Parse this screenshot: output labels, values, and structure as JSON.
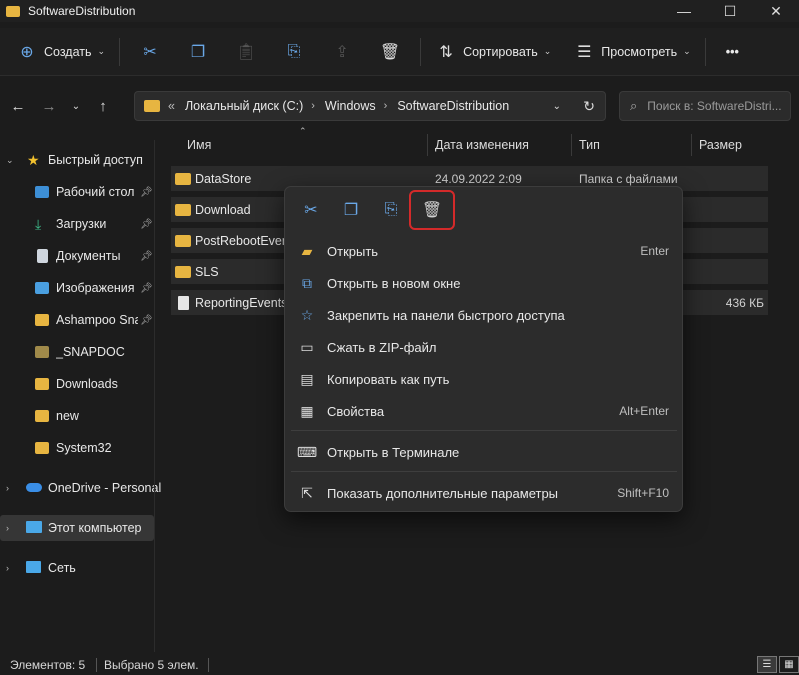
{
  "window": {
    "title": "SoftwareDistribution",
    "minimize_glyph": "—",
    "maximize_glyph": "☐",
    "close_glyph": "✕"
  },
  "toolbar": {
    "create_label": "Создать",
    "sort_label": "Сортировать",
    "view_label": "Просмотреть",
    "more_glyph": "•••"
  },
  "address": {
    "prefix": "«",
    "crumbs": [
      "Локальный диск (C:)",
      "Windows",
      "SoftwareDistribution"
    ],
    "search_placeholder": "Поиск в: SoftwareDistri..."
  },
  "sidebar": {
    "items": [
      {
        "label": "Быстрый доступ",
        "icon": "star-icon"
      },
      {
        "label": "Рабочий стол",
        "icon": "desktop-icon",
        "pinned": true
      },
      {
        "label": "Загрузки",
        "icon": "download-icon",
        "pinned": true
      },
      {
        "label": "Документы",
        "icon": "document-icon",
        "pinned": true
      },
      {
        "label": "Изображения",
        "icon": "image-icon",
        "pinned": true
      },
      {
        "label": "Ashampoo Sna",
        "icon": "folder-icon",
        "pinned": true
      },
      {
        "label": "_SNAPDOC",
        "icon": "folder-icon"
      },
      {
        "label": "Downloads",
        "icon": "folder-icon"
      },
      {
        "label": "new",
        "icon": "folder-icon"
      },
      {
        "label": "System32",
        "icon": "folder-icon"
      },
      {
        "label": "OneDrive - Personal",
        "icon": "cloud-icon"
      },
      {
        "label": "Этот компьютер",
        "icon": "computer-icon",
        "selected": true
      },
      {
        "label": "Сеть",
        "icon": "network-icon"
      }
    ]
  },
  "columns": {
    "name": "Имя",
    "date": "Дата изменения",
    "type": "Тип",
    "size": "Размер"
  },
  "files": [
    {
      "name": "DataStore",
      "date": "24.09.2022 2:09",
      "type": "Папка с файлами",
      "size": ""
    },
    {
      "name": "Download",
      "date": "",
      "type": "",
      "size": ""
    },
    {
      "name": "PostRebootEvent",
      "date": "",
      "type": "",
      "size": ""
    },
    {
      "name": "SLS",
      "date": "",
      "type": "",
      "size": ""
    },
    {
      "name": "ReportingEvents.",
      "date": "",
      "type": "",
      "size": "436 КБ"
    }
  ],
  "context_menu": {
    "items": [
      {
        "label": "Открыть",
        "shortcut": "Enter",
        "icon": "folder-open-icon"
      },
      {
        "label": "Открыть в новом окне",
        "shortcut": "",
        "icon": "new-window-icon"
      },
      {
        "label": "Закрепить на панели быстрого доступа",
        "shortcut": "",
        "icon": "star-outline-icon"
      },
      {
        "label": "Сжать в ZIP-файл",
        "shortcut": "",
        "icon": "zip-icon"
      },
      {
        "label": "Копировать как путь",
        "shortcut": "",
        "icon": "copy-path-icon"
      },
      {
        "label": "Свойства",
        "shortcut": "Alt+Enter",
        "icon": "properties-icon"
      },
      {
        "label": "Открыть в Терминале",
        "shortcut": "",
        "icon": "terminal-icon"
      },
      {
        "label": "Показать дополнительные параметры",
        "shortcut": "Shift+F10",
        "icon": "more-options-icon"
      }
    ]
  },
  "status": {
    "count": "Элементов: 5",
    "selected": "Выбрано 5 элем."
  },
  "colors": {
    "accent": "#6aa8e8",
    "folder": "#e7b541",
    "highlight_border": "#d42a2a"
  }
}
